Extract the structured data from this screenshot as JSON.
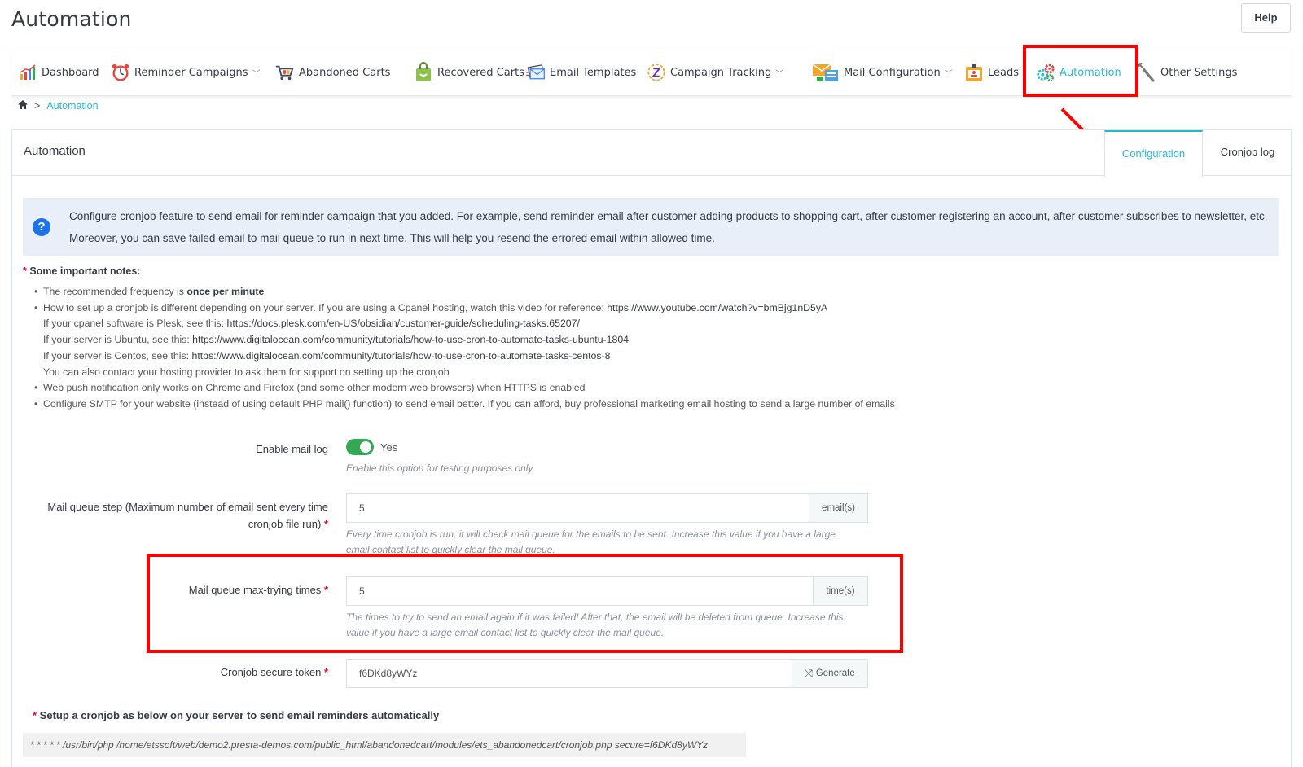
{
  "header": {
    "title": "Automation",
    "help_label": "Help"
  },
  "nav": {
    "items": [
      {
        "label": "Dashboard",
        "icon": "dashboard-chart-icon"
      },
      {
        "label": "Reminder Campaigns",
        "icon": "alarm-clock-icon",
        "dropdown": true
      },
      {
        "label": "Abandoned Carts",
        "icon": "shopping-cart-icon"
      },
      {
        "label": "Recovered Carts",
        "icon": "shopping-bag-icon"
      },
      {
        "label": "Email Templates",
        "icon": "email-templates-icon"
      },
      {
        "label": "Campaign Tracking",
        "icon": "tracking-icon",
        "dropdown": true
      },
      {
        "label": "Mail Configuration",
        "icon": "mail-server-icon",
        "dropdown": true
      },
      {
        "label": "Leads",
        "icon": "leads-icon"
      },
      {
        "label": "Automation",
        "icon": "gears-icon",
        "active": true
      },
      {
        "label": "Other Settings",
        "icon": "wrench-icon"
      }
    ]
  },
  "breadcrumb": {
    "current": "Automation"
  },
  "panel": {
    "title": "Automation",
    "tabs": [
      {
        "label": "Configuration",
        "active": true
      },
      {
        "label": "Cronjob log"
      }
    ]
  },
  "info": {
    "line1": "Configure cronjob feature to send email for reminder campaign that you added. For example, send reminder email after customer adding products to shopping cart, after customer registering an account, after customer subscribes to newsletter, etc.",
    "line2": "Moreover, you can save failed email to mail queue to run in next time. This will help you resend the errored email within allowed time."
  },
  "notes": {
    "title": "Some important notes:",
    "freq_prefix": "The recommended frequency is ",
    "freq_bold": "once per minute",
    "setup_prefix": "How to set up a cronjob is different depending on your server. If you are using a Cpanel hosting, watch this video for reference: ",
    "setup_link": "https://www.youtube.com/watch?v=bmBjg1nD5yA",
    "plesk_prefix": "If your cpanel software is Plesk, see this: ",
    "plesk_link": "https://docs.plesk.com/en-US/obsidian/customer-guide/scheduling-tasks.65207/",
    "ubuntu_prefix": "If your server is Ubuntu, see this: ",
    "ubuntu_link": "https://www.digitalocean.com/community/tutorials/how-to-use-cron-to-automate-tasks-ubuntu-1804",
    "centos_prefix": "If your server is Centos, see this: ",
    "centos_link": "https://www.digitalocean.com/community/tutorials/how-to-use-cron-to-automate-tasks-centos-8",
    "contact": "You can also contact your hosting provider to ask them for support on setting up the cronjob",
    "webpush": "Web push notification only works on Chrome and Firefox (and some other modern web browsers) when HTTPS is enabled",
    "smtp": "Configure SMTP for your website (instead of using default PHP mail() function) to send email better. If you can afford, buy professional marketing email hosting to send a large number of emails"
  },
  "form": {
    "mail_log": {
      "label": "Enable mail log",
      "value": "Yes",
      "help": "Enable this option for testing purposes only"
    },
    "queue_step": {
      "label_line1": "Mail queue step (Maximum number of email sent every time",
      "label_line2": "cronjob file run)",
      "value": "5",
      "addon": "email(s)",
      "help_line1": "Every time cronjob is run, it will check mail queue for the emails to be sent. Increase this value if you have a large",
      "help_line2": "email contact list to quickly clear the mail queue."
    },
    "max_trying": {
      "label": "Mail queue max-trying times",
      "value": "5",
      "addon": "time(s)",
      "help_line1": "The times to try to send an email again if it was failed! After that, the email will be deleted from queue. Increase this",
      "help_line2": "value if you have a large email contact list to quickly clear the mail queue."
    },
    "token": {
      "label": "Cronjob secure token",
      "value": "f6DKd8yWYz",
      "button": "Generate"
    }
  },
  "setup": {
    "title": "Setup a cronjob as below on your server to send email reminders automatically",
    "command": "* * * * * /usr/bin/php /home/etssoft/web/demo2.presta-demos.com/public_html/abandonedcart/modules/ets_abandonedcart/cronjob.php secure=f6DKd8yWYz"
  },
  "colors": {
    "accent": "#25b9d7",
    "highlight": "#ff0000",
    "toggle_on": "#34a853",
    "info_bg": "#e9eff9",
    "required": "#e4003a"
  }
}
